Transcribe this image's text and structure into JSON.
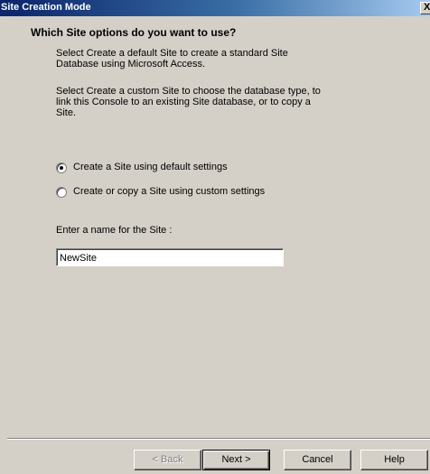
{
  "window": {
    "title": "Site Creation Mode",
    "close_glyph": "X"
  },
  "content": {
    "heading": "Which Site options do you want to use?",
    "paragraph1": "Select Create a default Site to create a standard Site Database using Microsoft Access.",
    "paragraph2": "Select Create a custom Site to choose the database type, to link this Console to an existing Site database, or to copy a Site.",
    "options": [
      {
        "label": "Create a Site using default settings",
        "selected": true
      },
      {
        "label": "Create or copy a Site using custom settings",
        "selected": false
      }
    ],
    "name_label": "Enter a name for the Site :",
    "name_value": "NewSite"
  },
  "buttons": {
    "back": "< Back",
    "next": "Next >",
    "cancel": "Cancel",
    "help": "Help"
  },
  "colors": {
    "titlebar_start": "#0a246a",
    "titlebar_end": "#a6caf0",
    "dialog_bg": "#d4d0c8"
  }
}
